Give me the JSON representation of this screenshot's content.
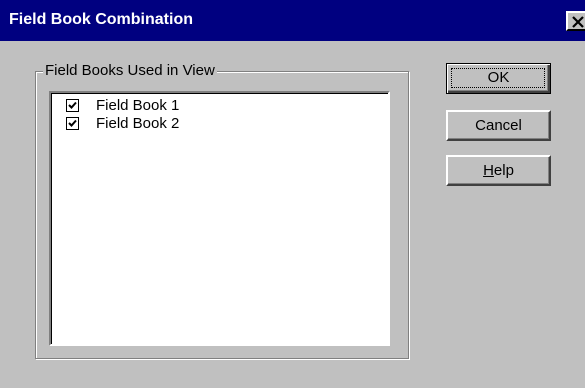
{
  "window": {
    "title": "Field Book Combination",
    "close_icon": "close-x-icon"
  },
  "group": {
    "label": "Field Books Used in View",
    "items": [
      {
        "label": "Field Book 1",
        "checked": true
      },
      {
        "label": "Field Book 2",
        "checked": true
      }
    ]
  },
  "buttons": {
    "ok_label": "OK",
    "cancel_label": "Cancel",
    "help_label": "Help",
    "help_mnemonic": "H",
    "help_rest": "elp"
  },
  "colors": {
    "titlebar": "#000080",
    "face": "#c0c0c0"
  }
}
